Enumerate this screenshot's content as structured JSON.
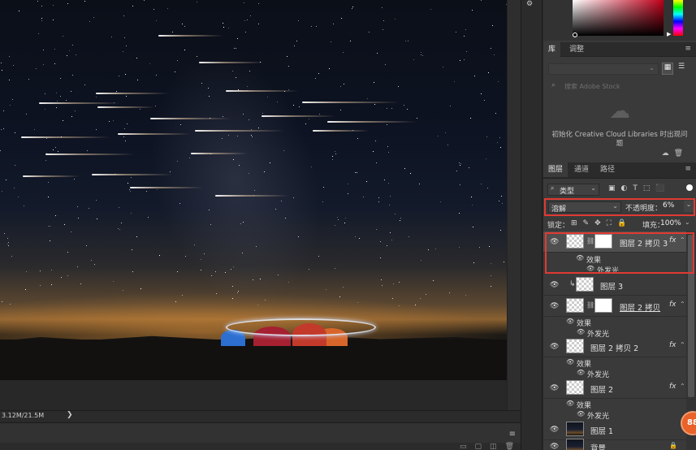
{
  "status": {
    "doc_size": "3.12M/21.5M",
    "arrow": "❯"
  },
  "timeline": {
    "menu_icon": "≡",
    "icons": [
      "▭",
      "▢",
      "◫",
      "🗑"
    ]
  },
  "panels": {
    "top_mini_icon": "⚙",
    "lib_tabs": [
      "库",
      "调整"
    ],
    "lib_menu_icon": "≡",
    "lib_search_placeholder": "搜索 Adobe Stock",
    "lib_message_line1": "初始化 Creative Cloud Libraries 时出现问",
    "lib_message_line2": "题",
    "lib_bottom_icons": [
      "☁",
      "🗑"
    ],
    "layer_tabs": [
      "图层",
      "通道",
      "路径"
    ],
    "layer_menu_icon": "≡"
  },
  "layers_panel": {
    "filter_kind_label": "类型",
    "filter_kind_icon": "⌕",
    "filter_icons": [
      "▣",
      "◐",
      "T",
      "⬚",
      "⬛"
    ],
    "blend_mode": "溶解",
    "opacity_label": "不透明度：",
    "opacity_value": "6%",
    "lock_label": "锁定：",
    "lock_icons": [
      "⊞",
      "✎",
      "✥",
      "⛶",
      "🔒"
    ],
    "fill_label": "填充：",
    "fill_value": "100%"
  },
  "layers": [
    {
      "name": "图层 2 拷贝 3",
      "fx": "fx",
      "has_mask": true,
      "selected": true,
      "underlined": false,
      "effects_label": "效果",
      "effect_name": "外发光"
    },
    {
      "name": "图层 3",
      "clipped": true
    },
    {
      "name": "图层 2 拷贝",
      "fx": "fx",
      "has_mask": true,
      "underlined": true,
      "effects_label": "效果",
      "effect_name": "外发光"
    },
    {
      "name": "图层 2 拷贝 2",
      "fx": "fx",
      "effects_label": "效果",
      "effect_name": "外发光"
    },
    {
      "name": "图层 2",
      "fx": "fx",
      "effects_label": "效果",
      "effect_name": "外发光"
    },
    {
      "name": "图层 1",
      "photo": true
    },
    {
      "name": "背景",
      "photo": true,
      "locked": true
    }
  ],
  "badge": "88",
  "colors": {
    "highlight": "#e03a33",
    "panel_bg": "#3a3a3a",
    "badge": "#e8622a"
  }
}
